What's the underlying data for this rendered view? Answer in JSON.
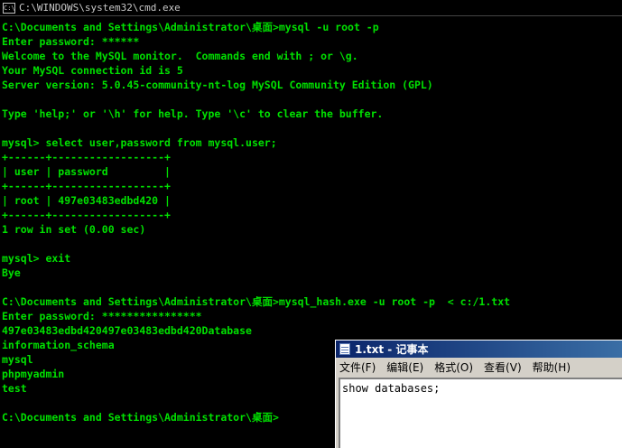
{
  "cmd_window": {
    "title": "C:\\WINDOWS\\system32\\cmd.exe",
    "lines": [
      "C:\\Documents and Settings\\Administrator\\桌面>mysql -u root -p",
      "Enter password: ******",
      "Welcome to the MySQL monitor.  Commands end with ; or \\g.",
      "Your MySQL connection id is 5",
      "Server version: 5.0.45-community-nt-log MySQL Community Edition (GPL)",
      "",
      "Type 'help;' or '\\h' for help. Type '\\c' to clear the buffer.",
      "",
      "mysql> select user,password from mysql.user;",
      "+------+------------------+",
      "| user | password         |",
      "+------+------------------+",
      "| root | 497e03483edbd420 |",
      "+------+------------------+",
      "1 row in set (0.00 sec)",
      "",
      "mysql> exit",
      "Bye",
      "",
      "C:\\Documents and Settings\\Administrator\\桌面>mysql_hash.exe -u root -p  < c:/1.txt",
      "Enter password: ****************",
      "497e03483edbd420497e03483edbd420Database",
      "information_schema",
      "mysql",
      "phpmyadmin",
      "test",
      "",
      "C:\\Documents and Settings\\Administrator\\桌面>"
    ]
  },
  "notepad": {
    "title": "1.txt - 记事本",
    "menu": [
      "文件(F)",
      "编辑(E)",
      "格式(O)",
      "查看(V)",
      "帮助(H)"
    ],
    "content": "show databases;"
  }
}
